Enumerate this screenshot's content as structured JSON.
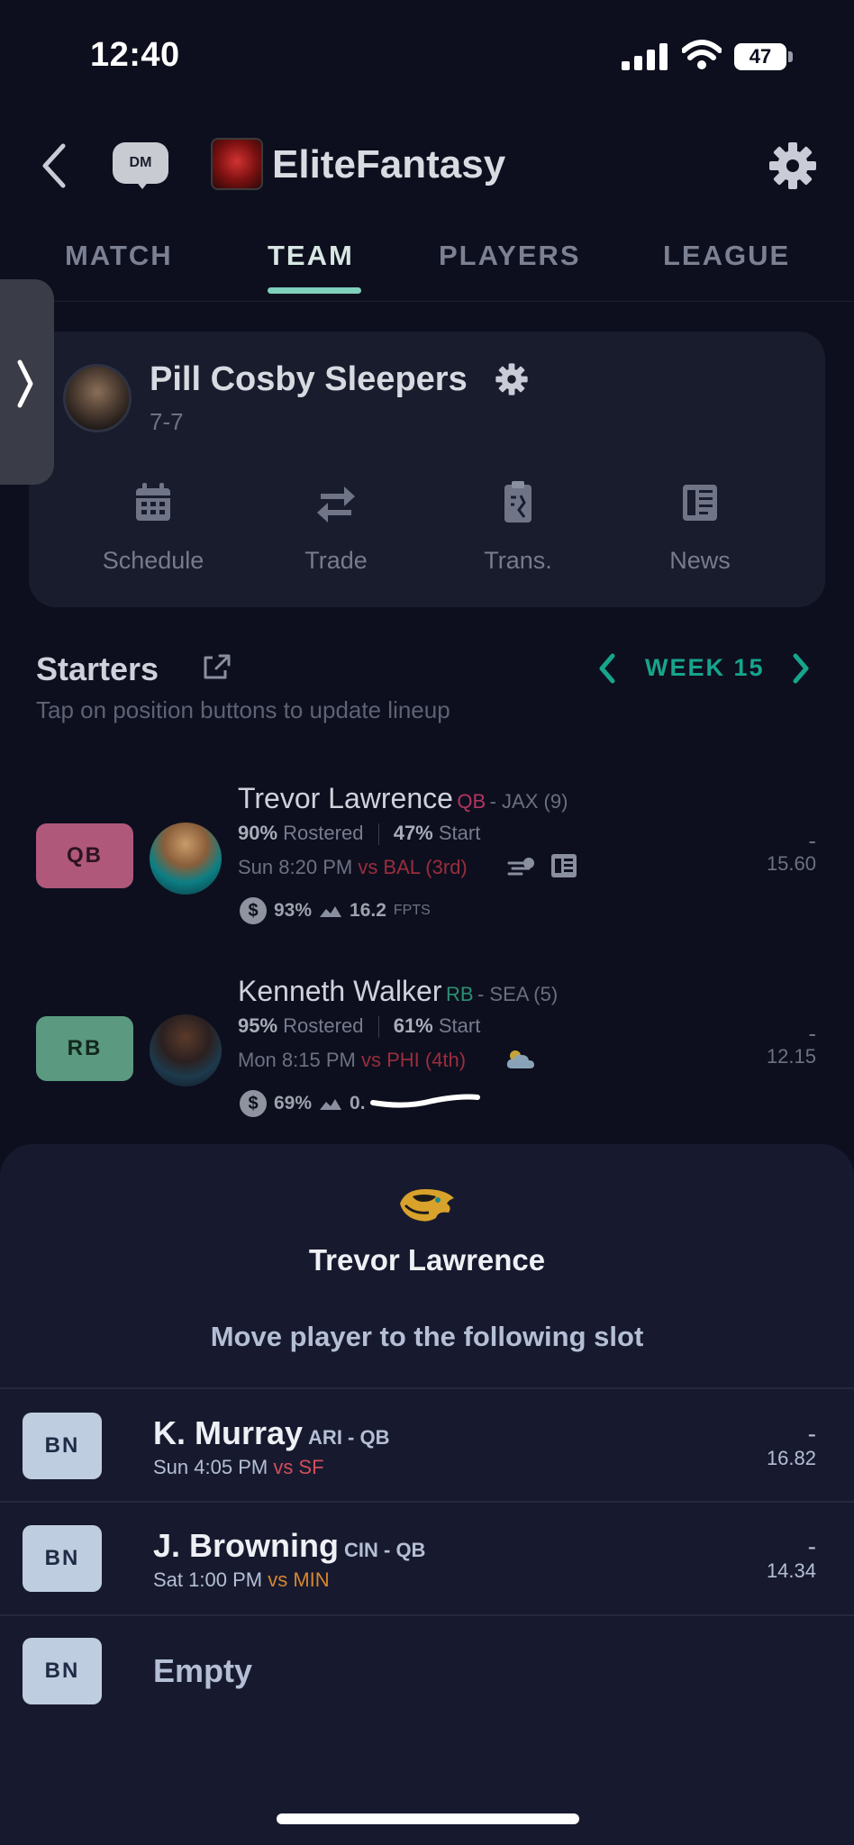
{
  "status_bar": {
    "time": "12:40",
    "battery": "47",
    "icons": [
      "signal-icon",
      "wifi-icon",
      "battery-icon"
    ]
  },
  "nav": {
    "dm_label": "DM",
    "app_title": "EliteFantasy",
    "icons": [
      "back-icon",
      "dm-icon",
      "app-logo",
      "gear-icon"
    ]
  },
  "tabs": [
    {
      "label": "MATCH",
      "active": false
    },
    {
      "label": "TEAM",
      "active": true
    },
    {
      "label": "PLAYERS",
      "active": false
    },
    {
      "label": "LEAGUE",
      "active": false
    }
  ],
  "team": {
    "name": "Pill Cosby Sleepers",
    "record": "7-7",
    "actions": [
      {
        "label": "Schedule",
        "icon": "calendar-icon"
      },
      {
        "label": "Trade",
        "icon": "trade-arrows-icon"
      },
      {
        "label": "Trans.",
        "icon": "clipboard-icon"
      },
      {
        "label": "News",
        "icon": "news-icon"
      }
    ]
  },
  "starters": {
    "title": "Starters",
    "subtitle": "Tap on position buttons to update lineup",
    "week_label": "WEEK 15",
    "players": [
      {
        "position": "QB",
        "name": "Trevor Lawrence",
        "pos_tag": "QB",
        "team_info": "- JAX (9)",
        "rostered": "90%",
        "rostered_label": "Rostered",
        "start": "47%",
        "start_label": "Start",
        "game_time": "Sun 8:20 PM",
        "opponent": "vs BAL (3rd)",
        "salary_pct": "93%",
        "fpts": "16.2",
        "fpts_label": "FPTS",
        "score": "-",
        "projection": "15.60"
      },
      {
        "position": "RB",
        "name": "Kenneth Walker",
        "pos_tag": "RB",
        "team_info": "- SEA (5)",
        "rostered": "95%",
        "rostered_label": "Rostered",
        "start": "61%",
        "start_label": "Start",
        "game_time": "Mon 8:15 PM",
        "opponent": "vs PHI (4th)",
        "salary_pct": "69%",
        "fpts": "0.",
        "score": "-",
        "projection": "12.15"
      }
    ]
  },
  "sheet": {
    "player_name": "Trevor Lawrence",
    "prompt": "Move player to the following slot",
    "slots": [
      {
        "slot": "BN",
        "name": "K. Murray",
        "team_pos": "ARI - QB",
        "game_time": "Sun 4:05 PM",
        "opponent": "vs SF",
        "score": "-",
        "projection": "16.82"
      },
      {
        "slot": "BN",
        "name": "J. Browning",
        "team_pos": "CIN - QB",
        "game_time": "Sat 1:00 PM",
        "opponent": "vs MIN",
        "score": "-",
        "projection": "14.34"
      },
      {
        "slot": "BN",
        "name": "Empty"
      }
    ]
  },
  "colors": {
    "background": "#0d0f1e",
    "accent_teal": "#16a58c",
    "qb_pill": "#b0587a",
    "rb_pill": "#5b9a80",
    "bench_pill": "#bfcde0",
    "sheet_bg": "#171a2e"
  }
}
